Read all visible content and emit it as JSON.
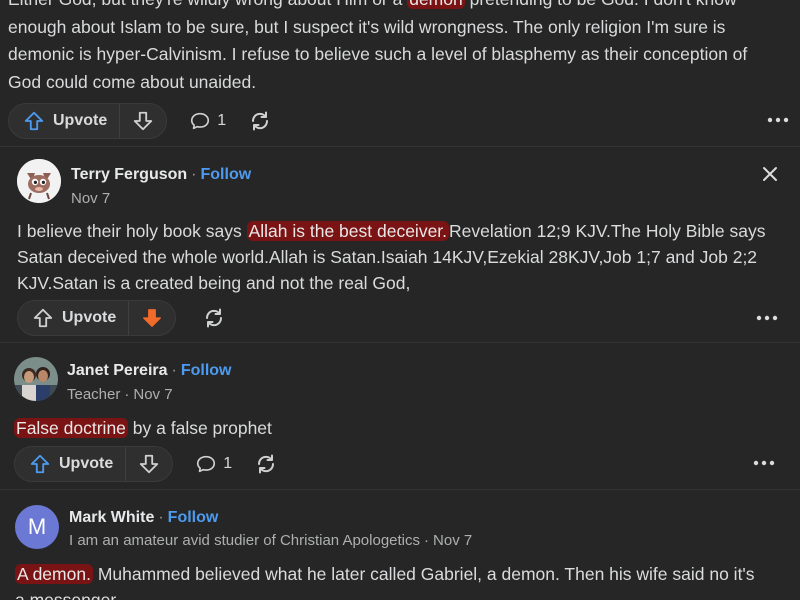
{
  "parent_answer": {
    "text_lines": [
      {
        "before": "Either God, but they're wildly wrong about Him or a ",
        "highlight": "demon",
        "after": " pretending to be God. I don't know"
      },
      {
        "before": "enough about Islam to be sure, but I suspect it's wild wrongness. The only religion I'm sure is",
        "highlight": "",
        "after": ""
      },
      {
        "before": "demonic is hyper-Calvinism. I refuse to believe such a level of blasphemy as their conception of",
        "highlight": "",
        "after": ""
      },
      {
        "before": "God could come about unaided.",
        "highlight": "",
        "after": ""
      }
    ],
    "upvote_label": "Upvote",
    "comment_count": "1"
  },
  "comments": [
    {
      "author": "Terry Ferguson",
      "follow_label": "Follow",
      "credential": "",
      "date": "Nov 7",
      "line1_before": "I believe their holy book says ",
      "line1_highlight": "Allah is the best deceiver.",
      "line1_after": "Revelation 12;9 KJV.The Holy Bible says",
      "line2": "Satan deceived the whole world.Allah is Satan.Isaiah 14KJV,Ezekial 28KJV,Job 1;7 and Job 2;2",
      "line3": "KJV.Satan is a created being and not the real God,",
      "upvote_label": "Upvote",
      "downvoted": true
    },
    {
      "author": "Janet Pereira",
      "follow_label": "Follow",
      "credential": "Teacher",
      "date": "Nov 7",
      "line1_highlight": "False doctrine",
      "line1_after": " by a false prophet",
      "upvote_label": "Upvote",
      "comment_count": "1"
    },
    {
      "author": "Mark White",
      "follow_label": "Follow",
      "credential": "I am an amateur avid studier of Christian Apologetics",
      "date": "Nov 7",
      "avatar_letter": "M",
      "line1_highlight": "A demon.",
      "line1_after": " Muhammed believed what he later called Gabriel, a demon. Then his wife said no it's",
      "line2": "a messenger."
    }
  ],
  "colors": {
    "accent_blue": "#4d9bf0",
    "downvote_orange": "#f06b2a",
    "highlight_red": "#7a1414",
    "avatar_purple": "#6b78d4"
  }
}
